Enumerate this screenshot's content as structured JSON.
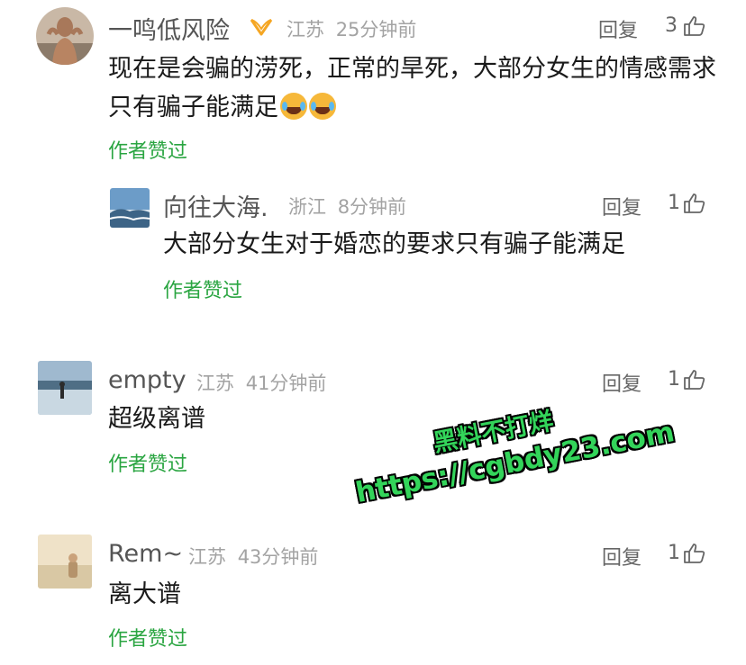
{
  "comments": [
    {
      "name": "一鸣低风险",
      "badge": "vip-badge-icon",
      "location": "江苏",
      "time": "25分钟前",
      "reply_label": "回复",
      "likes": "3",
      "body": "现在是会骗的涝死，正常的旱死，大部分女生的情感需求只有骗子能满足",
      "emoji": [
        "crying-laughing-emoji",
        "crying-laughing-emoji"
      ],
      "liked_by_author": "作者赞过"
    },
    {
      "name": "向往大海.",
      "location": "浙江",
      "time": "8分钟前",
      "reply_label": "回复",
      "likes": "1",
      "body": "大部分女生对于婚恋的要求只有骗子能满足",
      "liked_by_author": "作者赞过"
    },
    {
      "name": "empty",
      "location": "江苏",
      "time": "41分钟前",
      "reply_label": "回复",
      "likes": "1",
      "body": "超级离谱",
      "liked_by_author": "作者赞过"
    },
    {
      "name": "Rem~",
      "location": "江苏",
      "time": "43分钟前",
      "reply_label": "回复",
      "likes": "1",
      "body": "离大谱",
      "liked_by_author": "作者赞过"
    }
  ],
  "watermark": {
    "line1": "黑料不打烊",
    "line2": "https://cgbdy23.com"
  },
  "colors": {
    "liked_green": "#2aa541",
    "watermark_green": "#33d45a",
    "meta_gray": "#a3a3a3",
    "badge_orange": "#f5a623"
  }
}
